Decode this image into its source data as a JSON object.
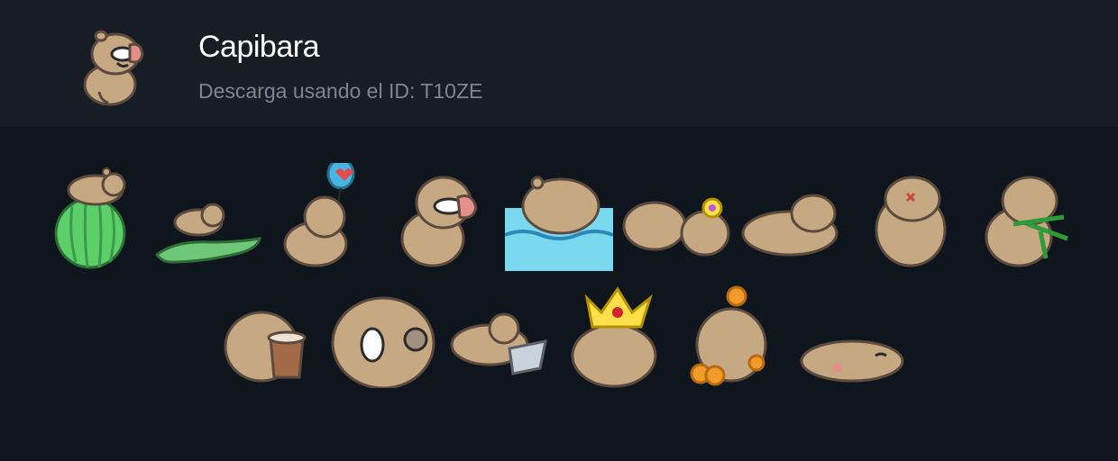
{
  "pack": {
    "title": "Capibara",
    "subtitle": "Descarga usando el ID: T10ZE",
    "icon": "capybara-with-nose-glasses-icon"
  },
  "colors": {
    "background": "#0f151c",
    "header_background": "#161d25",
    "capybara_fur": "#c6a882",
    "outline": "#5b4a3d"
  },
  "stickers": [
    {
      "name": "capybara-on-watermelon"
    },
    {
      "name": "capybara-riding-crocodile"
    },
    {
      "name": "capybara-with-heart-balloon"
    },
    {
      "name": "capybara-with-nose-glasses"
    },
    {
      "name": "capybara-in-water"
    },
    {
      "name": "capybara-with-gem-flower"
    },
    {
      "name": "capybara-lying"
    },
    {
      "name": "capybara-angry"
    },
    {
      "name": "capybara-eating-bamboo"
    },
    {
      "name": "capybara-with-bubble-tea"
    },
    {
      "name": "capybara-surprised"
    },
    {
      "name": "capybara-on-laptop"
    },
    {
      "name": "capybara-with-crown"
    },
    {
      "name": "capybara-with-oranges"
    },
    {
      "name": "capybara-sleeping"
    }
  ]
}
